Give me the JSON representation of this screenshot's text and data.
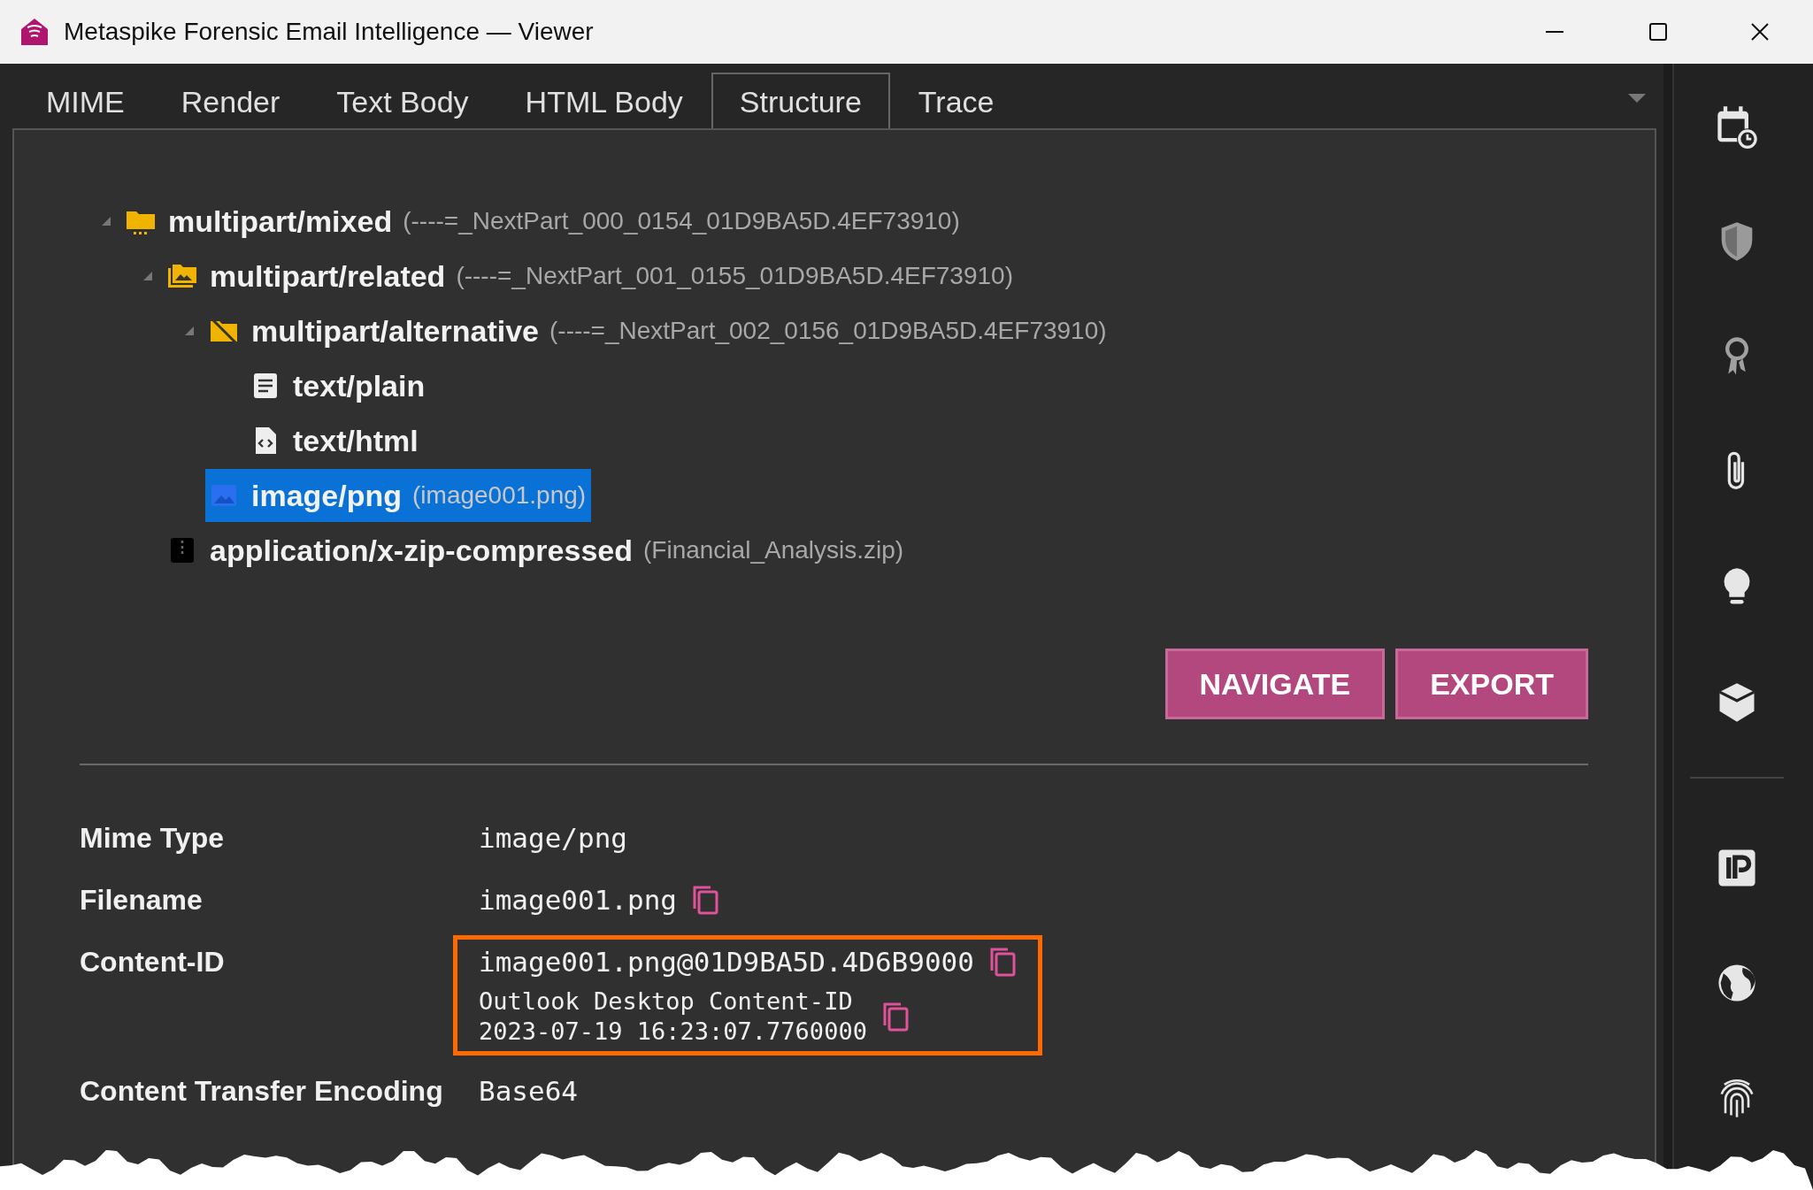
{
  "window": {
    "title": "Metaspike Forensic Email Intelligence — Viewer"
  },
  "tabs": [
    {
      "label": "MIME",
      "selected": false
    },
    {
      "label": "Render",
      "selected": false
    },
    {
      "label": "Text Body",
      "selected": false
    },
    {
      "label": "HTML Body",
      "selected": false
    },
    {
      "label": "Structure",
      "selected": true
    },
    {
      "label": "Trace",
      "selected": false
    }
  ],
  "tree": [
    {
      "type": "multipart/mixed",
      "detail": "(----=_NextPart_000_0154_01D9BA5D.4EF73910)",
      "kind": "folder",
      "selected": false,
      "expanded": true,
      "children": [
        {
          "type": "multipart/related",
          "detail": "(----=_NextPart_001_0155_01D9BA5D.4EF73910)",
          "kind": "folder-images",
          "selected": false,
          "expanded": true,
          "children": [
            {
              "type": "multipart/alternative",
              "detail": "(----=_NextPart_002_0156_01D9BA5D.4EF73910)",
              "kind": "folder-off",
              "selected": false,
              "expanded": true,
              "children": [
                {
                  "type": "text/plain",
                  "kind": "text",
                  "selected": false
                },
                {
                  "type": "text/html",
                  "kind": "code",
                  "selected": false
                }
              ]
            },
            {
              "type": "image/png",
              "detail": "(image001.png)",
              "kind": "image",
              "selected": true
            }
          ]
        },
        {
          "type": "application/x-zip-compressed",
          "detail": "(Financial_Analysis.zip)",
          "kind": "zip",
          "selected": false
        }
      ]
    }
  ],
  "actions": [
    "NAVIGATE",
    "EXPORT"
  ],
  "details": [
    {
      "label": "Mime Type",
      "highlighted": false,
      "values": [
        {
          "kind": "main",
          "text": "image/png",
          "copy": false
        }
      ]
    },
    {
      "label": "Filename",
      "highlighted": false,
      "values": [
        {
          "kind": "main",
          "text": "image001.png",
          "copy": true
        }
      ]
    },
    {
      "label": "Content-ID",
      "highlighted": true,
      "values": [
        {
          "kind": "main",
          "text": "image001.png@01D9BA5D.4D6B9000",
          "copy": true
        },
        {
          "kind": "note",
          "lines": [
            "Outlook Desktop Content-ID",
            "2023-07-19 16:23:07.7760000"
          ],
          "copy": true
        }
      ]
    },
    {
      "label": "Content Transfer Encoding",
      "highlighted": false,
      "values": [
        {
          "kind": "main",
          "text": "Base64",
          "copy": false
        }
      ]
    }
  ]
}
